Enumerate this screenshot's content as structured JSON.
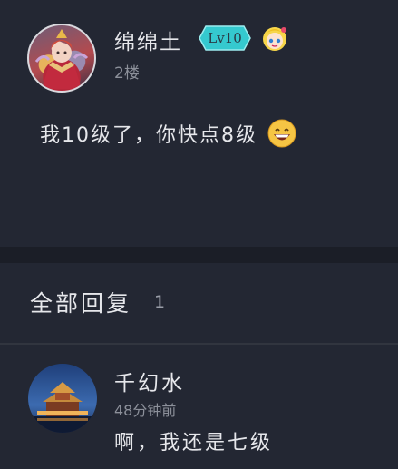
{
  "post": {
    "username": "绵绵土",
    "level": "Lv10",
    "floor": "2楼",
    "content": "我10级了，你快点8级",
    "avatar_icon": "hero-character-avatar",
    "mascot_icon": "anime-girl-mascot-icon",
    "emoji_icon": "grinning-face-emoji"
  },
  "replies": {
    "title": "全部回复",
    "count": "1",
    "items": [
      {
        "name": "千幻水",
        "time": "48分钟前",
        "text": "啊，我还是七级",
        "avatar_icon": "palace-night-avatar"
      }
    ]
  },
  "colors": {
    "background": "#232733",
    "separator": "#1b1e27",
    "text_primary": "#e6e7eb",
    "text_secondary": "#8c909a",
    "level_badge": "#35c9cf"
  }
}
